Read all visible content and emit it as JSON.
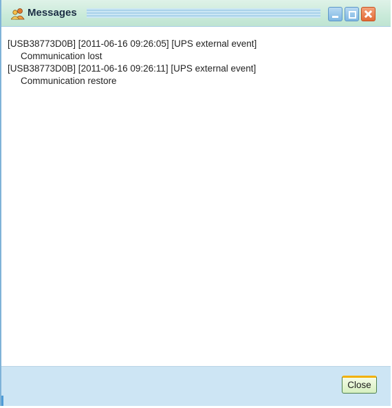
{
  "window": {
    "title": "Messages",
    "title_icon": "users-icon",
    "controls": [
      "minimize-icon",
      "maximize-icon",
      "close-icon"
    ]
  },
  "messages": [
    {
      "header": "[USB38773D0B] [2011-06-16 09:26:05] [UPS external event]",
      "body": "Communication lost"
    },
    {
      "header": "[USB38773D0B] [2011-06-16 09:26:11] [UPS external event]",
      "body": "Communication restore"
    }
  ],
  "footer": {
    "close_label": "Close"
  },
  "colors": {
    "title_bg": "#c9ead9",
    "footer_bg": "#cde5f4",
    "close_button_accent": "#f2b000",
    "window_close_button": "#e36b36"
  }
}
